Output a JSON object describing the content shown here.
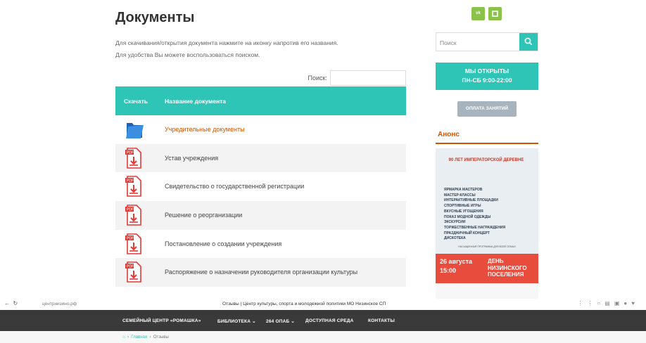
{
  "page": {
    "title": "Документы",
    "intro_line1": "Для скачивания/открытия документа нажмите на иконку напротив его названия.",
    "intro_line2": "Для удобства Вы можете воспользоваться поиском.",
    "search_label": "Поиск:"
  },
  "table": {
    "col_download": "Скачать",
    "col_name": "Название документа",
    "rows": [
      {
        "icon": "folder-icon",
        "name": "Учредительные документы"
      },
      {
        "icon": "pdf-icon",
        "name": "Устав учреждения"
      },
      {
        "icon": "pdf-icon",
        "name": "Свидетельство о государственной регистрации"
      },
      {
        "icon": "pdf-icon",
        "name": "Решение о реорганизации"
      },
      {
        "icon": "pdf-icon",
        "name": "Постановление о создании учреждения"
      },
      {
        "icon": "pdf-icon",
        "name": "Распоряжение о назначении руководителя организации культуры"
      }
    ]
  },
  "sidebar": {
    "social": [
      "vk",
      "ok"
    ],
    "search_placeholder": "Поиск",
    "open_line1": "МЫ ОТКРЫТЫ",
    "open_line2": "ПН-СБ 9:00-22:00",
    "pay_button": "ОПЛАТА ЗАНЯТИЙ",
    "anons_title": "Анонс",
    "poster": {
      "arc_text": "90 ЛЕТ ИМПЕРАТОРСКОЙ ДЕРЕВНЕ",
      "items": [
        "ЯРМАРКА МАСТЕРОВ",
        "МАСТЕР-КЛАССЫ",
        "ИНТЕРАКТИВНЫЕ ПЛОЩАДКИ",
        "СПОРТИВНЫЕ ИГРЫ",
        "ВКУСНЫЕ УГОЩЕНИЯ",
        "ПОКАЗ МОДНОЙ ОДЕЖДЫ",
        "ЭКСКУРСИИ",
        "ТОРЖЕСТВЕННЫЕ НАГРАЖДЕНИЯ",
        "ПРАЗДНИЧНЫЙ КОНЦЕРТ",
        "ДИСКОТЕКА"
      ],
      "small_text": "НАСЫЩЕННАЯ ПРОГРАММА ДЛЯ ВСЕЙ СЕМЬИ",
      "date_line1": "26 августа",
      "date_line2": "15:00",
      "holiday_line1": "ДЕНЬ",
      "holiday_line2": "НИЗИНСКОГО",
      "holiday_line3": "ПОСЕЛЕНИЯ"
    }
  },
  "browser": {
    "url": "центрнизино.рф",
    "tab_title": "Отзывы | Центр культуры, спорта и молодежной политики МО Низинское СП"
  },
  "sitenav": {
    "items": [
      "СЕМЕЙНЫЙ ЦЕНТР «РОМАШКА»",
      "БИБЛИОТЕКА ⌄",
      "264 ОПАБ ⌄",
      "ДОСТУПНАЯ СРЕДА",
      "КОНТАКТЫ"
    ]
  },
  "breadcrumbs": {
    "home": "Главная",
    "current": "Отзывы"
  },
  "colors": {
    "accent": "#2ec4b6",
    "link": "#d35400",
    "social": "#8bc34a",
    "nav_bg": "#3a3a3a"
  }
}
